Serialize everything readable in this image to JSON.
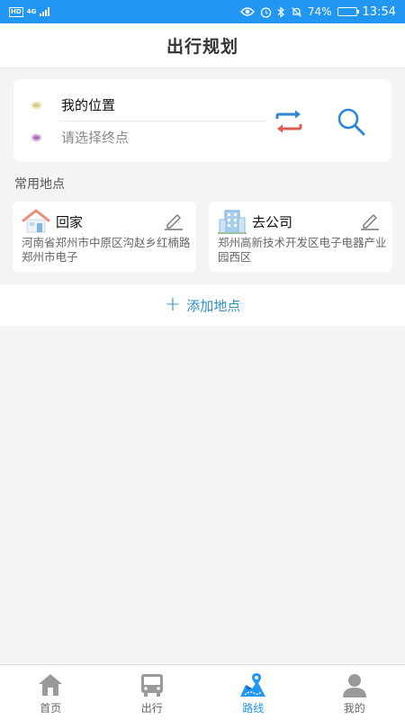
{
  "status_bar": {
    "network": "HD",
    "network_type": "4G",
    "battery_percent": "74%",
    "battery_level": 0.74,
    "time": "13:54",
    "icons": [
      "eye-icon",
      "alarm-icon",
      "bluetooth-icon",
      "mute-icon"
    ]
  },
  "header": {
    "title": "出行规划"
  },
  "route": {
    "start_label": "我的位置",
    "end_placeholder": "请选择终点",
    "swap_icon": "swap-arrows-icon",
    "search_icon": "magnifier-icon"
  },
  "favorites": {
    "section_title": "常用地点",
    "places": [
      {
        "name": "回家",
        "icon": "house-icon",
        "address": "河南省郑州市中原区沟赵乡红楠路郑州市电子"
      },
      {
        "name": "去公司",
        "icon": "office-building-icon",
        "address": "郑州高新技术开发区电子电器产业园西区"
      }
    ],
    "add_label": "添加地点"
  },
  "tabbar": {
    "tabs": [
      {
        "label": "首页",
        "icon": "home-icon",
        "active": false
      },
      {
        "label": "出行",
        "icon": "bus-icon",
        "active": false
      },
      {
        "label": "路线",
        "icon": "route-map-icon",
        "active": true
      },
      {
        "label": "我的",
        "icon": "user-icon",
        "active": false
      }
    ]
  },
  "colors": {
    "accent": "#2196f3",
    "link": "#2f8fc9",
    "background": "#f4f4f4"
  }
}
